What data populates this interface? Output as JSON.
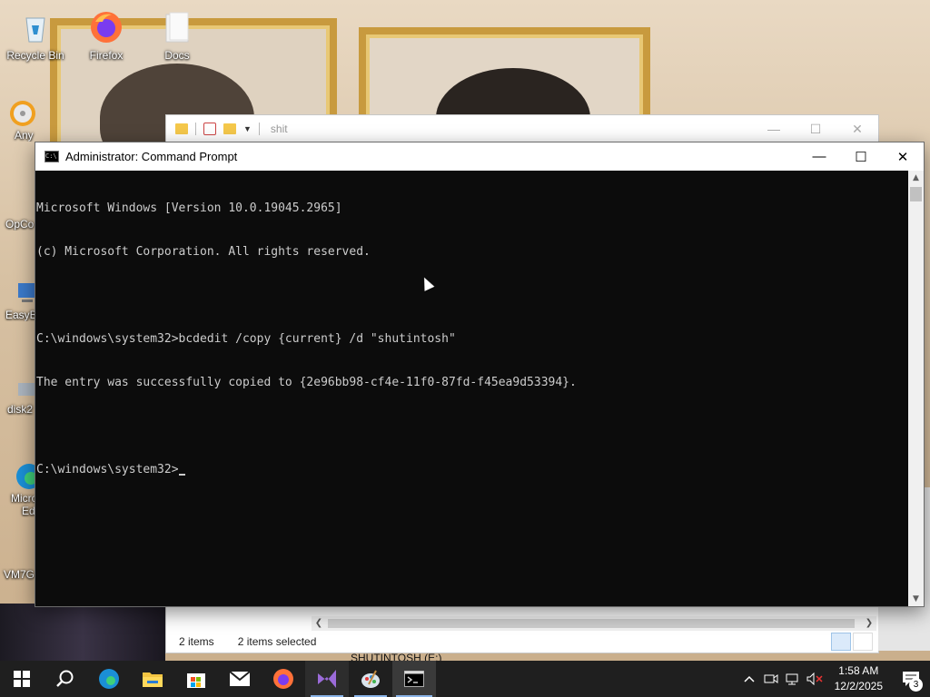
{
  "desktop": {
    "icons": [
      {
        "label": "Recycle Bin"
      },
      {
        "label": "Firefox"
      },
      {
        "label": "Docs"
      }
    ],
    "partial_labels": [
      "Any",
      "OpCo",
      "EasyB",
      "disk2",
      "Micro",
      "Ed",
      "VM7G"
    ]
  },
  "explorer": {
    "title": "shit",
    "status_items": "2 items",
    "status_selected": "2 items selected",
    "drive_label": "SHUTINTOSH (E:)"
  },
  "cmd": {
    "title": "Administrator: Command Prompt",
    "lines": [
      "Microsoft Windows [Version 10.0.19045.2965]",
      "(c) Microsoft Corporation. All rights reserved.",
      "",
      "C:\\windows\\system32>bcdedit /copy {current} /d \"shutintosh\"",
      "The entry was successfully copied to {2e96bb98-cf4e-11f0-87fd-f45ea9d53394}.",
      "",
      "C:\\windows\\system32>"
    ]
  },
  "taskbar": {
    "apps": [
      {
        "icon": "start-icon"
      },
      {
        "icon": "search-icon"
      },
      {
        "icon": "edge-icon"
      },
      {
        "icon": "file-explorer-icon"
      },
      {
        "icon": "store-icon"
      },
      {
        "icon": "mail-icon"
      },
      {
        "icon": "firefox-icon"
      },
      {
        "icon": "visual-studio-icon"
      },
      {
        "icon": "paint-icon"
      },
      {
        "icon": "command-prompt-icon"
      }
    ],
    "time": "1:58 AM",
    "date": "12/2/2025",
    "notification_count": "3"
  },
  "colors": {
    "console_bg": "#0c0c0c",
    "console_fg": "#cccccc",
    "taskbar_bg": "#1f1f1f",
    "accent": "#8ab4e8"
  }
}
